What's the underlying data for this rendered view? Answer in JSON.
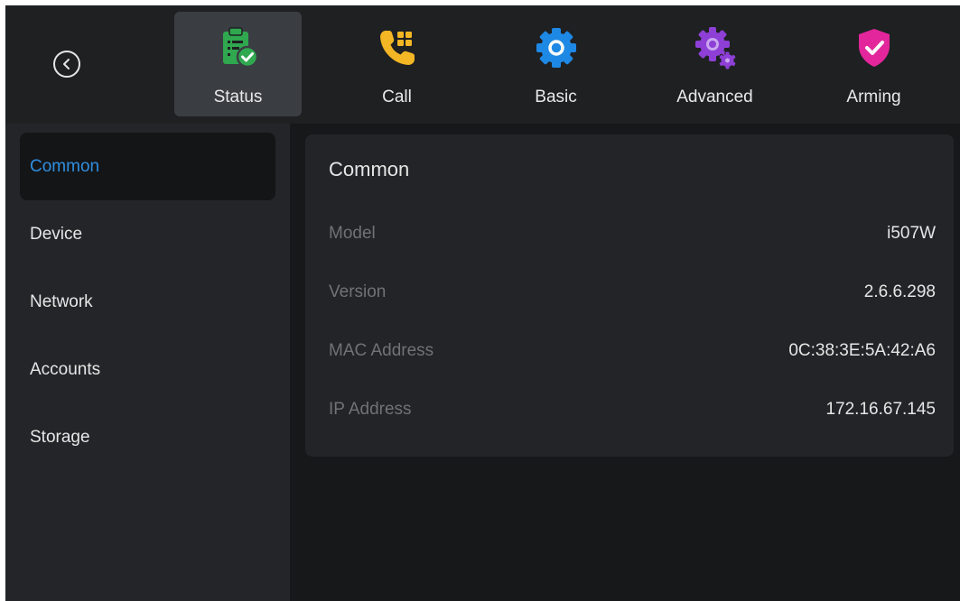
{
  "nav": {
    "tabs": [
      {
        "label": "Status",
        "icon": "status-clipboard-check-icon",
        "color": "#2fa84f",
        "active": true
      },
      {
        "label": "Call",
        "icon": "phone-icon",
        "color": "#f3b624"
      },
      {
        "label": "Basic",
        "icon": "gear-icon",
        "color": "#1e88e5"
      },
      {
        "label": "Advanced",
        "icon": "advanced-gears-icon",
        "color": "#8e3fd6"
      },
      {
        "label": "Arming",
        "icon": "shield-check-icon",
        "color": "#e3269b"
      }
    ]
  },
  "sidebar": {
    "items": [
      {
        "label": "Common",
        "active": true
      },
      {
        "label": "Device"
      },
      {
        "label": "Network"
      },
      {
        "label": "Accounts"
      },
      {
        "label": "Storage"
      }
    ]
  },
  "main": {
    "title": "Common",
    "rows": [
      {
        "label": "Model",
        "value": "i507W"
      },
      {
        "label": "Version",
        "value": "2.6.6.298"
      },
      {
        "label": "MAC Address",
        "value": "0C:38:3E:5A:42:A6"
      },
      {
        "label": "IP Address",
        "value": "172.16.67.145"
      }
    ]
  },
  "colors": {
    "accent": "#2f8fe0",
    "background": "#17181a",
    "panel": "#222427"
  }
}
